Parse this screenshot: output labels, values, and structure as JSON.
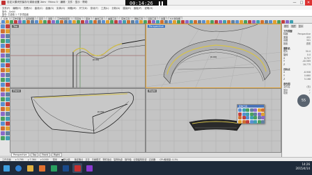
{
  "window": {
    "title": "自定义模块的保存与调用设置.3dm · Rhino 5 · 编辑 · 文件 · 显示 · 帮助",
    "recording_time": "00:14:26",
    "controls": [
      "—",
      "□",
      "✕"
    ]
  },
  "menu": [
    "文件(F)",
    "编辑(E)",
    "查看(V)",
    "曲线(C)",
    "曲面(S)",
    "实体(O)",
    "网格(M)",
    "尺寸(D)",
    "变动(T)",
    "工具(L)",
    "分析(A)",
    "渲染(R)",
    "面板(P)",
    "说明(H)"
  ],
  "command_lines": [
    "指令: _SelAll",
    "指令: 已选取 1 个多重曲面",
    "指令:"
  ],
  "toolbar_tabs": [
    "标准",
    "工作平面",
    "设置视图",
    "显示",
    "选取",
    "工作视窗配置",
    "可见性",
    "变动",
    "曲线工具",
    "曲面工具",
    "实体工具",
    "网格工具",
    "渲染工具",
    "出图",
    "5.0 新功能"
  ],
  "viewports": [
    {
      "label": "Top"
    },
    {
      "label": "Perspective"
    },
    {
      "label": "Front"
    },
    {
      "label": "Right"
    }
  ],
  "viewport_tabs": [
    "Perspective",
    "Top",
    "Front",
    "Right"
  ],
  "right_panel": {
    "tabs": [
      "属性",
      "图层",
      "显示"
    ],
    "section_object": "工作视窗",
    "rows": [
      {
        "k": "标题",
        "v": "Perspective"
      },
      {
        "k": "宽度",
        "v": "452"
      },
      {
        "k": "高度",
        "v": "301"
      },
      {
        "k": "投影",
        "v": "透视"
      }
    ],
    "section_camera": "摄影机",
    "camera_rows": [
      {
        "k": "镜头",
        "v": "50.0"
      },
      {
        "k": "旋转",
        "v": "0.0"
      },
      {
        "k": "X",
        "v": "6.707"
      },
      {
        "k": "Y",
        "v": "-40.569"
      },
      {
        "k": "Z",
        "v": "18.775"
      }
    ],
    "section_target": "目标点",
    "target_rows": [
      {
        "k": "X",
        "v": "-6.908"
      },
      {
        "k": "Y",
        "v": "0.660"
      },
      {
        "k": "Z",
        "v": "5.168"
      }
    ],
    "section_wallpaper": "底色图",
    "wallpaper_rows": [
      {
        "k": "文件名",
        "v": "(无)"
      },
      {
        "k": "显示",
        "v": "✓"
      },
      {
        "k": "灰阶",
        "v": "✓"
      }
    ],
    "badge": "55"
  },
  "palette": {
    "title": "实体工具"
  },
  "status": {
    "cplane": "工作平面",
    "x": "x 3.795",
    "y": "y 7.364",
    "z": "z 0.000",
    "units": "毫米",
    "layer": "■默认值",
    "toggles": [
      "锁定格点",
      "正交",
      "平面模式",
      "物件锁点",
      "智慧轨迹",
      "操作轴",
      "记录建构历史",
      "过滤器"
    ],
    "memory": "CPU使用量: 0.3%"
  },
  "taskbar": {
    "time": "14:26",
    "date": "2015/4/14"
  }
}
